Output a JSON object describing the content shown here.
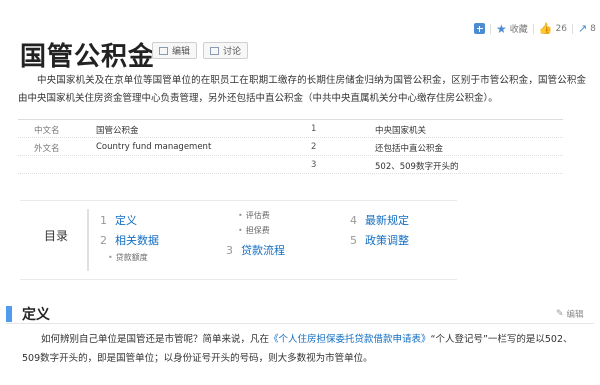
{
  "toolbar": {
    "collect_label": "收藏",
    "like_count": "26",
    "share_count": "8"
  },
  "header": {
    "title": "国管公积金",
    "edit_label": "编辑",
    "discuss_label": "讨论"
  },
  "summary": "中央国家机关及在京单位等国管单位的在职员工在职期工缴存的长期住房储金归纳为国管公积金，区别于市管公积金，国管公积金由中央国家机关住房资金管理中心负责管理，另外还包括中直公积金（中共中央直属机关分中心缴存住房公积金）。",
  "infobox": [
    {
      "label": "中文名",
      "value": "国管公积金",
      "num": "1",
      "text": "中央国家机关"
    },
    {
      "label": "外文名",
      "value": "Country fund management",
      "num": "2",
      "text": "还包括中直公积金"
    },
    {
      "label": "",
      "value": "",
      "num": "3",
      "text": "502、509数字开头的"
    }
  ],
  "toc": {
    "label": "目录",
    "items": [
      {
        "num": "1",
        "label": "定义"
      },
      {
        "num": "2",
        "label": "相关数据"
      },
      {
        "num": "3",
        "label": "贷款流程"
      },
      {
        "num": "4",
        "label": "最新规定"
      },
      {
        "num": "5",
        "label": "政策调整"
      }
    ],
    "subs": [
      "贷款额度",
      "评估费",
      "担保费"
    ]
  },
  "section": {
    "title": "定义",
    "edit_label": "编辑",
    "body_part1": "如何辨别自己单位是国管还是市管呢？简单来说，凡在",
    "body_link": "《个人住房担保委托贷款借款申请表》",
    "body_part2": "“个人登记号”一栏写的是以502、509数字开头的，即是国管单位；以身份证号开头的号码，则大多数视为市管单位。"
  }
}
